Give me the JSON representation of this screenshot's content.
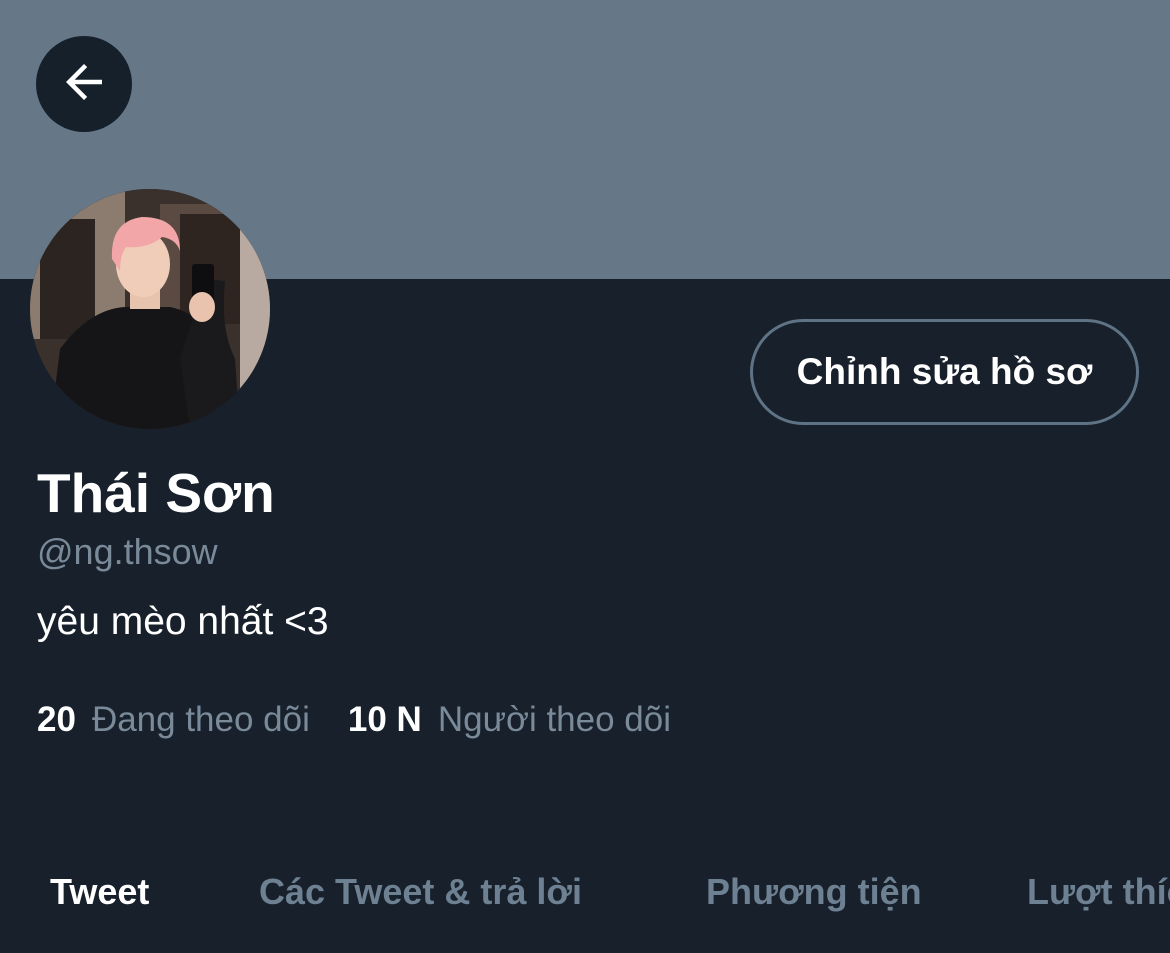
{
  "header": {
    "back_icon": "arrow-left-icon"
  },
  "profile": {
    "display_name": "Thái Sơn",
    "handle": "@ng.thsow",
    "bio": "yêu mèo nhất <3",
    "edit_button_label": "Chỉnh sửa hồ sơ"
  },
  "stats": {
    "following_count": "20",
    "following_label": "Đang theo dõi",
    "followers_count": "10 N",
    "followers_label": "Người theo dõi"
  },
  "tabs": [
    {
      "label": "Tweet",
      "active": true
    },
    {
      "label": "Các Tweet & trả lời",
      "active": false
    },
    {
      "label": "Phương tiện",
      "active": false
    },
    {
      "label": "Lượt thích",
      "active": false
    }
  ],
  "colors": {
    "banner": "#667788",
    "background": "#17202b",
    "text_primary": "#ffffff",
    "text_secondary": "#7a8a99",
    "button_border": "#5f7386"
  }
}
